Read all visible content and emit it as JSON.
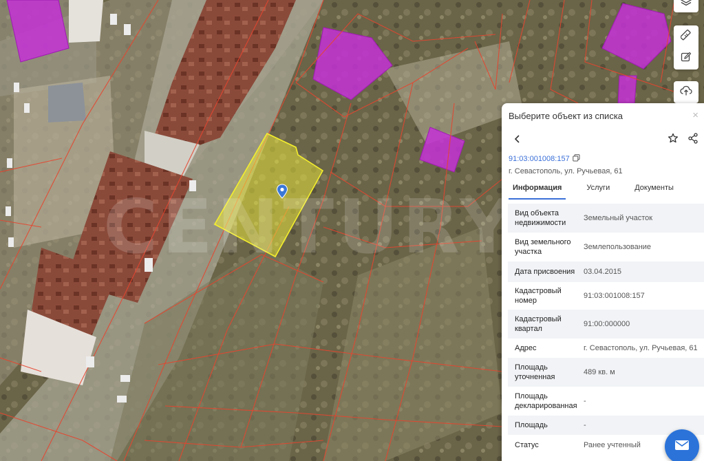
{
  "watermark": "CENTURY",
  "panel": {
    "title": "Выберите объект из списка",
    "close": "×",
    "cadastral_number": "91:03:001008:157",
    "address": "г. Севастополь, ул. Ручьевая, 61",
    "tabs": [
      {
        "label": "Информация",
        "active": true
      },
      {
        "label": "Услуги",
        "active": false
      },
      {
        "label": "Документы",
        "active": false
      }
    ],
    "fields": [
      {
        "key": "Вид объекта недвижимости",
        "value": "Земельный участок"
      },
      {
        "key": "Вид земельного участка",
        "value": "Землепользование"
      },
      {
        "key": "Дата присвоения",
        "value": "03.04.2015"
      },
      {
        "key": "Кадастровый номер",
        "value": "91:03:001008:157"
      },
      {
        "key": "Кадастровый квартал",
        "value": "91:00:000000"
      },
      {
        "key": "Адрес",
        "value": "г. Севастополь, ул. Ручьевая, 61"
      },
      {
        "key": "Площадь уточненная",
        "value": "489 кв. м"
      },
      {
        "key": "Площадь декларированная",
        "value": "-"
      },
      {
        "key": "Площадь",
        "value": "-"
      },
      {
        "key": "Статус",
        "value": "Ранее учтенный"
      }
    ]
  },
  "icons": {
    "layers": "layers-icon",
    "ruler": "ruler-icon",
    "edit": "edit-icon",
    "upload": "upload-icon",
    "pin": "map-pin-icon",
    "back": "back-arrow-icon",
    "star": "star-icon",
    "share": "share-icon",
    "copy": "copy-icon",
    "mail": "mail-icon"
  },
  "colors": {
    "selected_parcel": "#f1ee3a",
    "parcel_border": "#e5452f",
    "building_highlight": "#c431d6",
    "accent": "#2b73d9"
  }
}
